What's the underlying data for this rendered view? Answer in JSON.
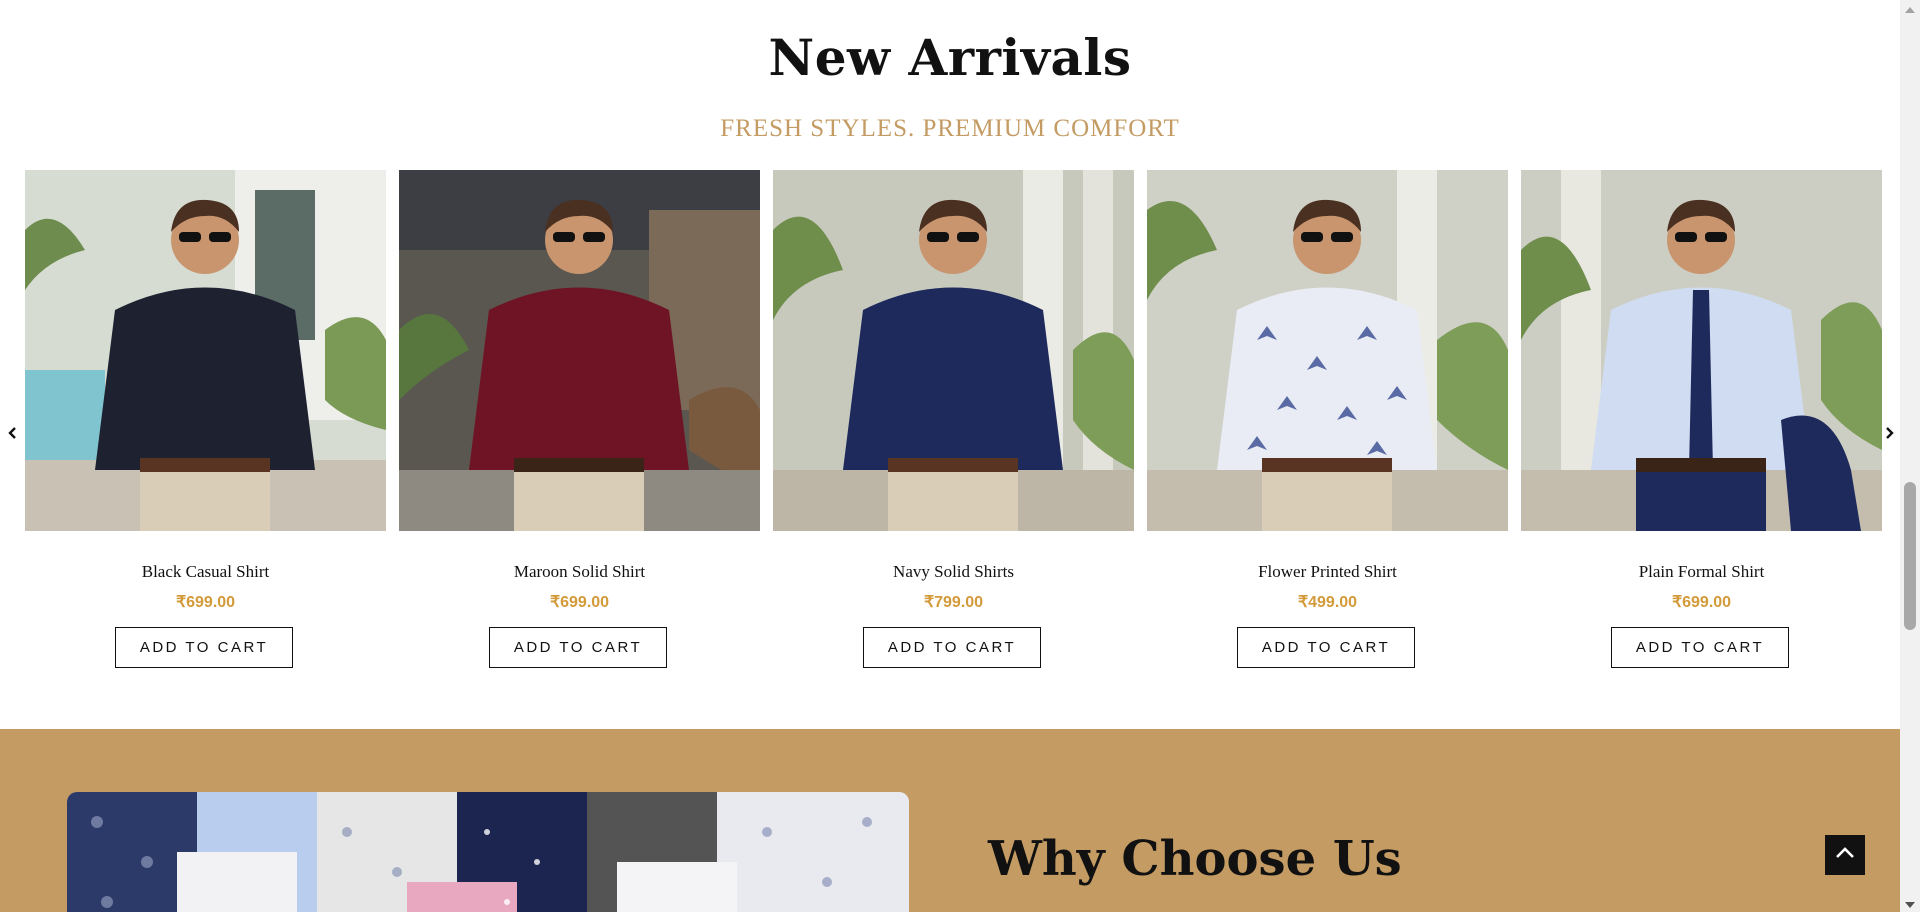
{
  "new_arrivals": {
    "title": "New Arrivals",
    "subtitle": "FRESH STYLES. PREMIUM COMFORT",
    "products": [
      {
        "name": "Black Casual Shirt",
        "price": "₹699.00",
        "button": "ADD TO CART",
        "shirt_color": "#1d2130"
      },
      {
        "name": "Maroon Solid Shirt",
        "price": "₹699.00",
        "button": "ADD TO CART",
        "shirt_color": "#6e1424"
      },
      {
        "name": "Navy Solid Shirts",
        "price": "₹799.00",
        "button": "ADD TO CART",
        "shirt_color": "#1f2a5c"
      },
      {
        "name": "Flower Printed Shirt",
        "price": "₹499.00",
        "button": "ADD TO CART",
        "shirt_color": "#e9ecf4"
      },
      {
        "name": "Plain Formal Shirt",
        "price": "₹699.00",
        "button": "ADD TO CART",
        "shirt_color": "#cfdcf2"
      }
    ]
  },
  "why_choose": {
    "title": "Why Choose Us"
  },
  "colors": {
    "accent": "#c49b63",
    "price": "#d39a3a",
    "text": "#111111"
  },
  "icons": {
    "prev": "chevron-left-icon",
    "next": "chevron-right-icon",
    "back_to_top": "chevron-up-icon"
  }
}
